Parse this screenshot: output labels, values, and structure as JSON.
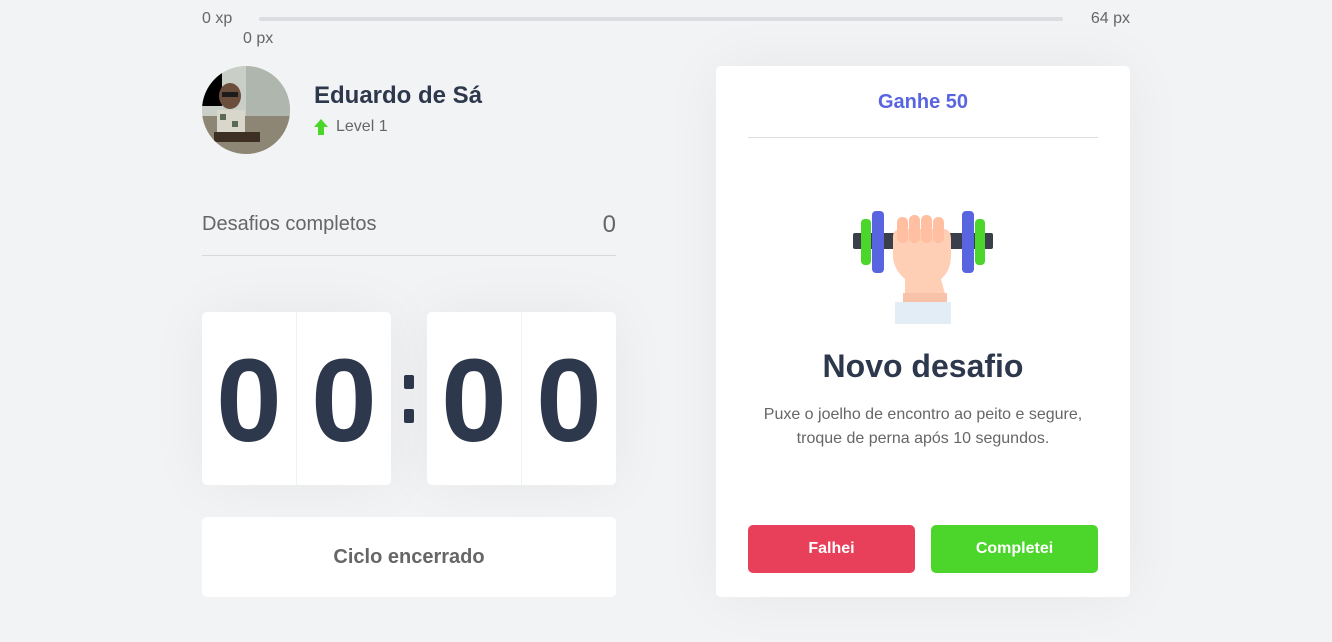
{
  "xp": {
    "start_label": "0 xp",
    "end_label": "64 px",
    "current_label": "0 px",
    "progress": 0
  },
  "profile": {
    "name": "Eduardo de Sá",
    "level": "Level 1"
  },
  "completed": {
    "label": "Desafios completos",
    "value": "0"
  },
  "countdown": {
    "minute_left": "0",
    "minute_right": "0",
    "second_left": "0",
    "second_right": "0"
  },
  "cycle": {
    "button_label": "Ciclo encerrado"
  },
  "challenge": {
    "header": "Ganhe 50",
    "icon": "dumbbell-icon",
    "title": "Novo desafio",
    "description": "Puxe o joelho de encontro ao peito e segure, troque de perna após 10 segundos.",
    "fail_label": "Falhei",
    "success_label": "Completei"
  },
  "colors": {
    "background": "#f2f3f5",
    "title": "#2e384d",
    "text": "#666666",
    "accent_blue": "#5965e0",
    "red": "#e83f5b",
    "green": "#4cd62b"
  }
}
